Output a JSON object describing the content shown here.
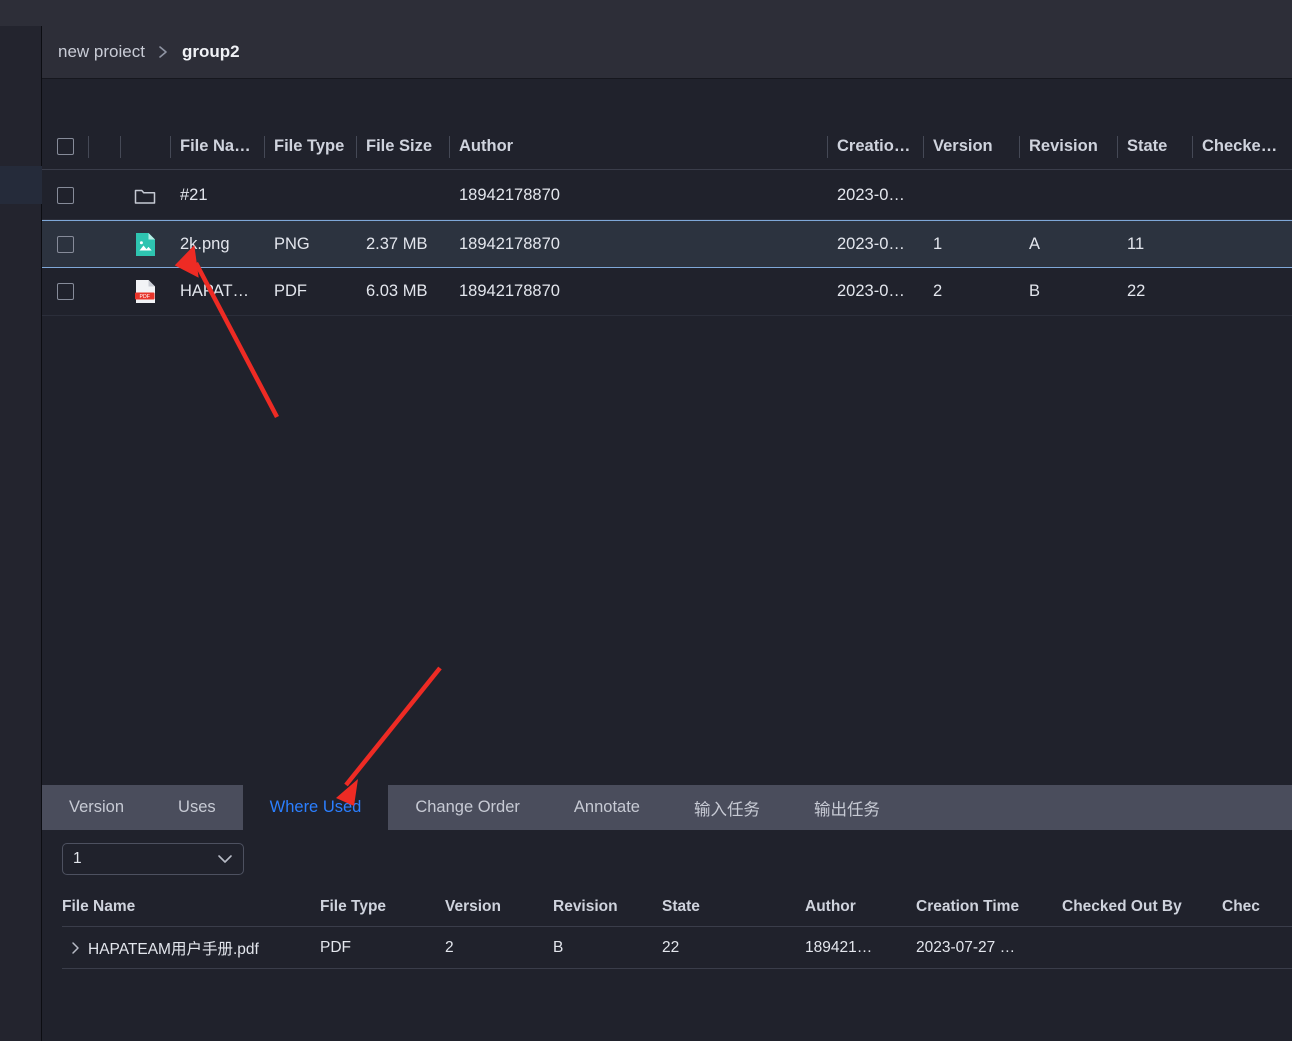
{
  "breadcrumb": {
    "items": [
      {
        "label": "new proiect",
        "current": false
      },
      {
        "label": "group2",
        "current": true
      }
    ],
    "separator_icon": "chevron-right-icon"
  },
  "file_table": {
    "columns": [
      {
        "key": "checkbox",
        "label": ""
      },
      {
        "key": "spacer1",
        "label": ""
      },
      {
        "key": "icon",
        "label": ""
      },
      {
        "key": "file_name",
        "label": "File Na…"
      },
      {
        "key": "file_type",
        "label": "File Type"
      },
      {
        "key": "file_size",
        "label": "File Size"
      },
      {
        "key": "author",
        "label": "Author"
      },
      {
        "key": "creation_time",
        "label": "Creatio…"
      },
      {
        "key": "version",
        "label": "Version"
      },
      {
        "key": "revision",
        "label": "Revision"
      },
      {
        "key": "state",
        "label": "State"
      },
      {
        "key": "checked_out_by",
        "label": "Checke…"
      }
    ],
    "rows": [
      {
        "icon": "folder-icon",
        "file_name": "#21",
        "file_type": "",
        "file_size": "",
        "author": "18942178870",
        "creation_time": "2023-0…",
        "version": "",
        "revision": "",
        "state": "",
        "checked_out_by": "",
        "selected": false
      },
      {
        "icon": "image-file-icon",
        "file_name": "2k.png",
        "file_type": "PNG",
        "file_size": "2.37 MB",
        "author": "18942178870",
        "creation_time": "2023-0…",
        "version": "1",
        "revision": "A",
        "state": "11",
        "checked_out_by": "",
        "selected": true
      },
      {
        "icon": "pdf-file-icon",
        "file_name": "HAPAT…",
        "file_type": "PDF",
        "file_size": "6.03 MB",
        "author": "18942178870",
        "creation_time": "2023-0…",
        "version": "2",
        "revision": "B",
        "state": "22",
        "checked_out_by": "",
        "selected": false
      }
    ]
  },
  "bottom_panel": {
    "tabs": [
      {
        "label": "Version",
        "active": false,
        "cjk": false
      },
      {
        "label": "Uses",
        "active": false,
        "cjk": false
      },
      {
        "label": "Where Used",
        "active": true,
        "cjk": false
      },
      {
        "label": "Change Order",
        "active": false,
        "cjk": false
      },
      {
        "label": "Annotate",
        "active": false,
        "cjk": false
      },
      {
        "label": "输入任务",
        "active": false,
        "cjk": true
      },
      {
        "label": "输出任务",
        "active": false,
        "cjk": true
      }
    ],
    "level_select": {
      "value": "1",
      "chevron_icon": "chevron-down-icon"
    },
    "columns": [
      {
        "key": "file_name",
        "label": "File Name"
      },
      {
        "key": "file_type",
        "label": "File Type"
      },
      {
        "key": "version",
        "label": "Version"
      },
      {
        "key": "revision",
        "label": "Revision"
      },
      {
        "key": "state",
        "label": "State"
      },
      {
        "key": "author",
        "label": "Author"
      },
      {
        "key": "creation_time",
        "label": "Creation Time"
      },
      {
        "key": "checked_out_by",
        "label": "Checked Out By"
      },
      {
        "key": "checked_out_at",
        "label": "Chec"
      }
    ],
    "rows": [
      {
        "expander_icon": "chevron-right-icon",
        "file_name": "HAPATEAM用户手册.pdf",
        "file_type": "PDF",
        "version": "2",
        "revision": "B",
        "state": "22",
        "author": "189421…",
        "creation_time": "2023-07-27 …",
        "checked_out_by": "",
        "checked_out_at": ""
      }
    ]
  },
  "annotations": {
    "arrow_color": "#ee2b24",
    "arrows": [
      {
        "name": "arrow-to-file-name",
        "points_to": "2k.png"
      },
      {
        "name": "arrow-to-where-used-tab",
        "points_to": "Where Used"
      }
    ]
  },
  "colors": {
    "background": "#20222c",
    "panel": "#2d2e38",
    "tabbar": "#4a4d5c",
    "selected_row": "#2c333f",
    "selected_border": "#7fa8d8",
    "active_tab_text": "#2b7fff",
    "png_icon": "#2ec4b0",
    "pdf_icon": "#e8352b"
  }
}
